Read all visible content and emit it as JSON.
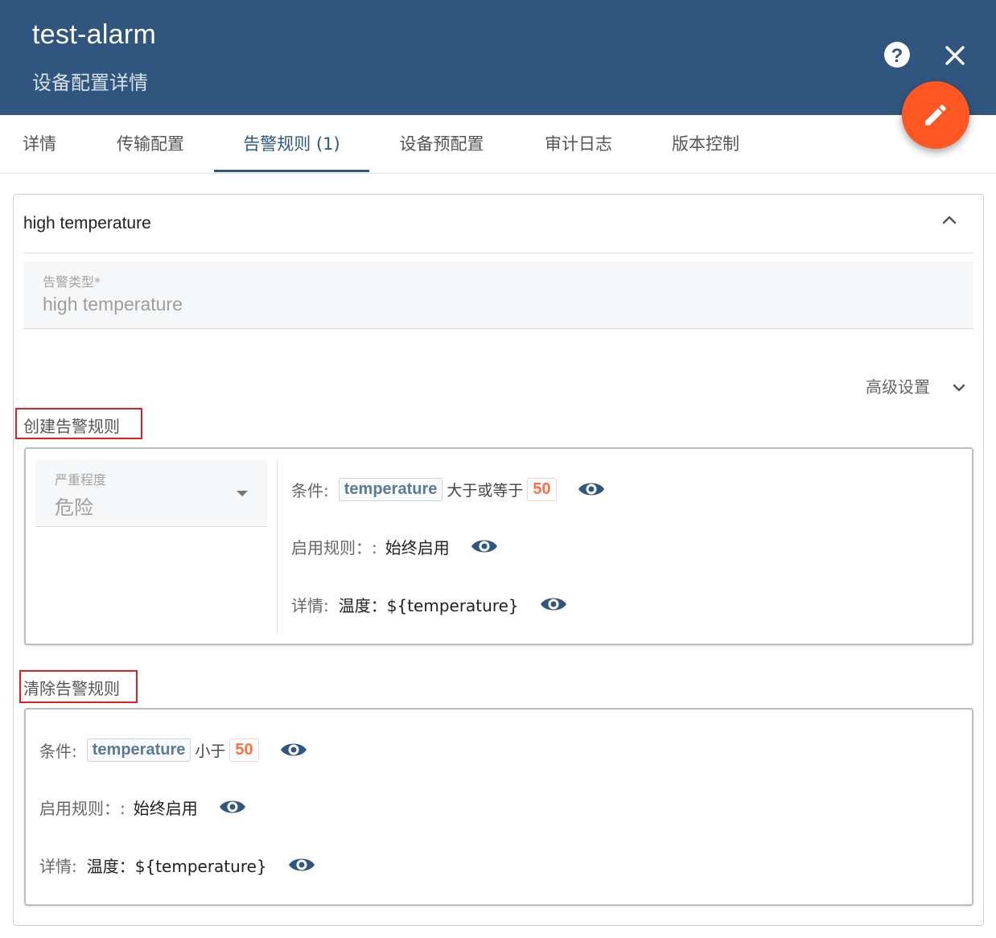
{
  "header": {
    "title": "test-alarm",
    "subtitle": "设备配置详情",
    "help_icon": "help-circle-icon",
    "close_icon": "close-icon",
    "edit_icon": "pencil-icon",
    "background_color": "#305680",
    "fab_color": "#ff5722"
  },
  "tabs": [
    {
      "label": "详情"
    },
    {
      "label": "传输配置"
    },
    {
      "label": "告警规则 (1)",
      "active": true
    },
    {
      "label": "设备预配置"
    },
    {
      "label": "审计日志"
    },
    {
      "label": "版本控制"
    }
  ],
  "alarm": {
    "title": "high temperature",
    "type_label": "告警类型*",
    "type_value": "high temperature",
    "advanced_label": "高级设置",
    "create_rules": {
      "section_label": "创建告警规则",
      "severity_label": "严重程度",
      "severity_value": "危险",
      "condition_label": "条件:",
      "condition_key": "temperature",
      "condition_op": "大于或等于",
      "condition_value": "50",
      "schedule_label": "启用规则：:",
      "schedule_value": "始终启用",
      "details_label": "详情:",
      "details_value": "温度：${temperature}"
    },
    "clear_rule": {
      "section_label": "清除告警规则",
      "condition_label": "条件:",
      "condition_key": "temperature",
      "condition_op": "小于",
      "condition_value": "50",
      "schedule_label": "启用规则：:",
      "schedule_value": "始终启用",
      "details_label": "详情:",
      "details_value": "温度：${temperature}"
    }
  }
}
